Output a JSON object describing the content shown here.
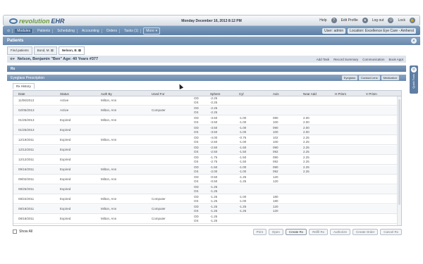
{
  "app": {
    "logo_a": "revolution",
    "logo_b": "EHR",
    "datetime": "Monday December 16, 2013   8:12 PM"
  },
  "topright": {
    "help": "Help",
    "edit_profile": "Edit Profile",
    "logout": "Log out",
    "lock": "Lock"
  },
  "nav": {
    "items": [
      "Modules",
      "Patients",
      "Scheduling",
      "Accounting",
      "Orders",
      "Tasks (1)"
    ],
    "more": "More",
    "user_label": "User:",
    "user_value": "admin",
    "location_label": "Location:",
    "location_value": "Excellence Eye Care - Amherst"
  },
  "page_title": "Patients",
  "patient_tabs": [
    "Find patients",
    "Bond, M.",
    "Nelson, B."
  ],
  "patient": {
    "name": "Nelson, Benjamin \"Ben\"  Age: 40 Years  #377",
    "add_task": "Add Task",
    "record_summary": "Record Summary",
    "communication": "Communication",
    "book_appt": "Book Appt"
  },
  "rx_header": "Rx",
  "eyeglass": {
    "title": "Eyeglass Prescription",
    "btns": [
      "Eyeglass",
      "Contact Lens",
      "Medication"
    ]
  },
  "side_label": "Quick Tools",
  "history_tab": "Rx History",
  "columns": [
    "Date",
    "Status",
    "Auth By",
    "Used For",
    "Sphere",
    "Cyl",
    "Axis",
    "Near Add",
    "H Prism",
    "V Prism"
  ],
  "rows": [
    {
      "date": "11/06/2013",
      "status": "Active",
      "auth": "Milton, Ann",
      "used": "",
      "sph": [
        "-2.25",
        "-2.25"
      ],
      "cyl": [
        "",
        ""
      ],
      "axis": [
        "",
        ""
      ],
      "add": [
        "",
        ""
      ]
    },
    {
      "date": "02/05/2013",
      "status": "Active",
      "auth": "Milton, Ann",
      "used": "Computer",
      "sph": [
        "-2.25",
        "-2.25"
      ],
      "cyl": [
        "",
        ""
      ],
      "axis": [
        "",
        ""
      ],
      "add": [
        "",
        ""
      ]
    },
    {
      "date": "01/25/2013",
      "status": "Expired",
      "auth": "Milton, Ann",
      "used": "",
      "sph": [
        "-3.50",
        "-3.50"
      ],
      "cyl": [
        "-1.00",
        "-1.00"
      ],
      "axis": [
        "090",
        "100"
      ],
      "add": [
        "2.00",
        "2.00"
      ]
    },
    {
      "date": "01/25/2013",
      "status": "Expired",
      "auth": "",
      "used": "",
      "sph": [
        "-3.50",
        "-3.50"
      ],
      "cyl": [
        "-1.00",
        "-1.00"
      ],
      "axis": [
        "090",
        "100"
      ],
      "add": [
        "2.00",
        "2.00"
      ]
    },
    {
      "date": "12/19/2011",
      "status": "Expired",
      "auth": "Milton, Ann",
      "used": "",
      "sph": [
        "-4.00",
        "-2.50"
      ],
      "cyl": [
        "-0.75",
        "-1.00"
      ],
      "axis": [
        "102",
        "100"
      ],
      "add": [
        "2.25",
        "2.25"
      ]
    },
    {
      "date": "12/12/2011",
      "status": "Expired",
      "auth": "",
      "used": "",
      "sph": [
        "-2.50",
        "-2.50"
      ],
      "cyl": [
        "-1.50",
        "-1.50"
      ],
      "axis": [
        "090",
        "092"
      ],
      "add": [
        "2.25",
        "2.25"
      ]
    },
    {
      "date": "12/12/2011",
      "status": "Expired",
      "auth": "",
      "used": "",
      "sph": [
        "-1.75",
        "-2.75"
      ],
      "cyl": [
        "-1.50",
        "-1.50"
      ],
      "axis": [
        "090",
        "092"
      ],
      "add": [
        "2.25",
        "2.25"
      ]
    },
    {
      "date": "09/16/2011",
      "status": "Expired",
      "auth": "Milton, Ann",
      "used": "",
      "sph": [
        "-1.50",
        "-2.00"
      ],
      "cyl": [
        "-1.00",
        "-1.00"
      ],
      "axis": [
        "090",
        "092"
      ],
      "add": [
        "2.25",
        "2.25"
      ]
    },
    {
      "date": "09/02/2011",
      "status": "Expired",
      "auth": "Milton, Ann",
      "used": "",
      "sph": [
        "-0.50",
        "-0.50"
      ],
      "cyl": [
        "-1.25",
        "-1.25"
      ],
      "axis": [
        "120",
        "120"
      ],
      "add": [
        "",
        ""
      ]
    },
    {
      "date": "08/25/2011",
      "status": "Expired",
      "auth": "",
      "used": "",
      "sph": [
        "-1.25",
        "-1.25"
      ],
      "cyl": [
        "",
        ""
      ],
      "axis": [
        "",
        ""
      ],
      "add": [
        "",
        ""
      ]
    },
    {
      "date": "08/22/2011",
      "status": "Expired",
      "auth": "Milton, Ann",
      "used": "Computer",
      "sph": [
        "-1.25",
        "-1.25"
      ],
      "cyl": [
        "-1.00",
        "-1.00"
      ],
      "axis": [
        "180",
        "180"
      ],
      "add": [
        "",
        ""
      ]
    },
    {
      "date": "08/18/2011",
      "status": "Expired",
      "auth": "Milton, Ann",
      "used": "Computer",
      "sph": [
        "-1.25",
        "-1.25"
      ],
      "cyl": [
        "-1.25",
        "-1.25"
      ],
      "axis": [
        "120",
        "120"
      ],
      "add": [
        "",
        ""
      ]
    },
    {
      "date": "08/18/2011",
      "status": "Expired",
      "auth": "Milton, Ann",
      "used": "Computer",
      "sph": [
        "-1.25",
        "-1.25"
      ],
      "cyl": [
        "",
        ""
      ],
      "axis": [
        "",
        ""
      ],
      "add": [
        "",
        ""
      ]
    }
  ],
  "eye_labels": [
    "OD",
    "OS"
  ],
  "footer": {
    "show_all": "Show All",
    "buttons": [
      "Print",
      "Open",
      "Create Rx",
      "Refill Rx",
      "Authorize",
      "Create Order",
      "Cancel Rx"
    ]
  }
}
